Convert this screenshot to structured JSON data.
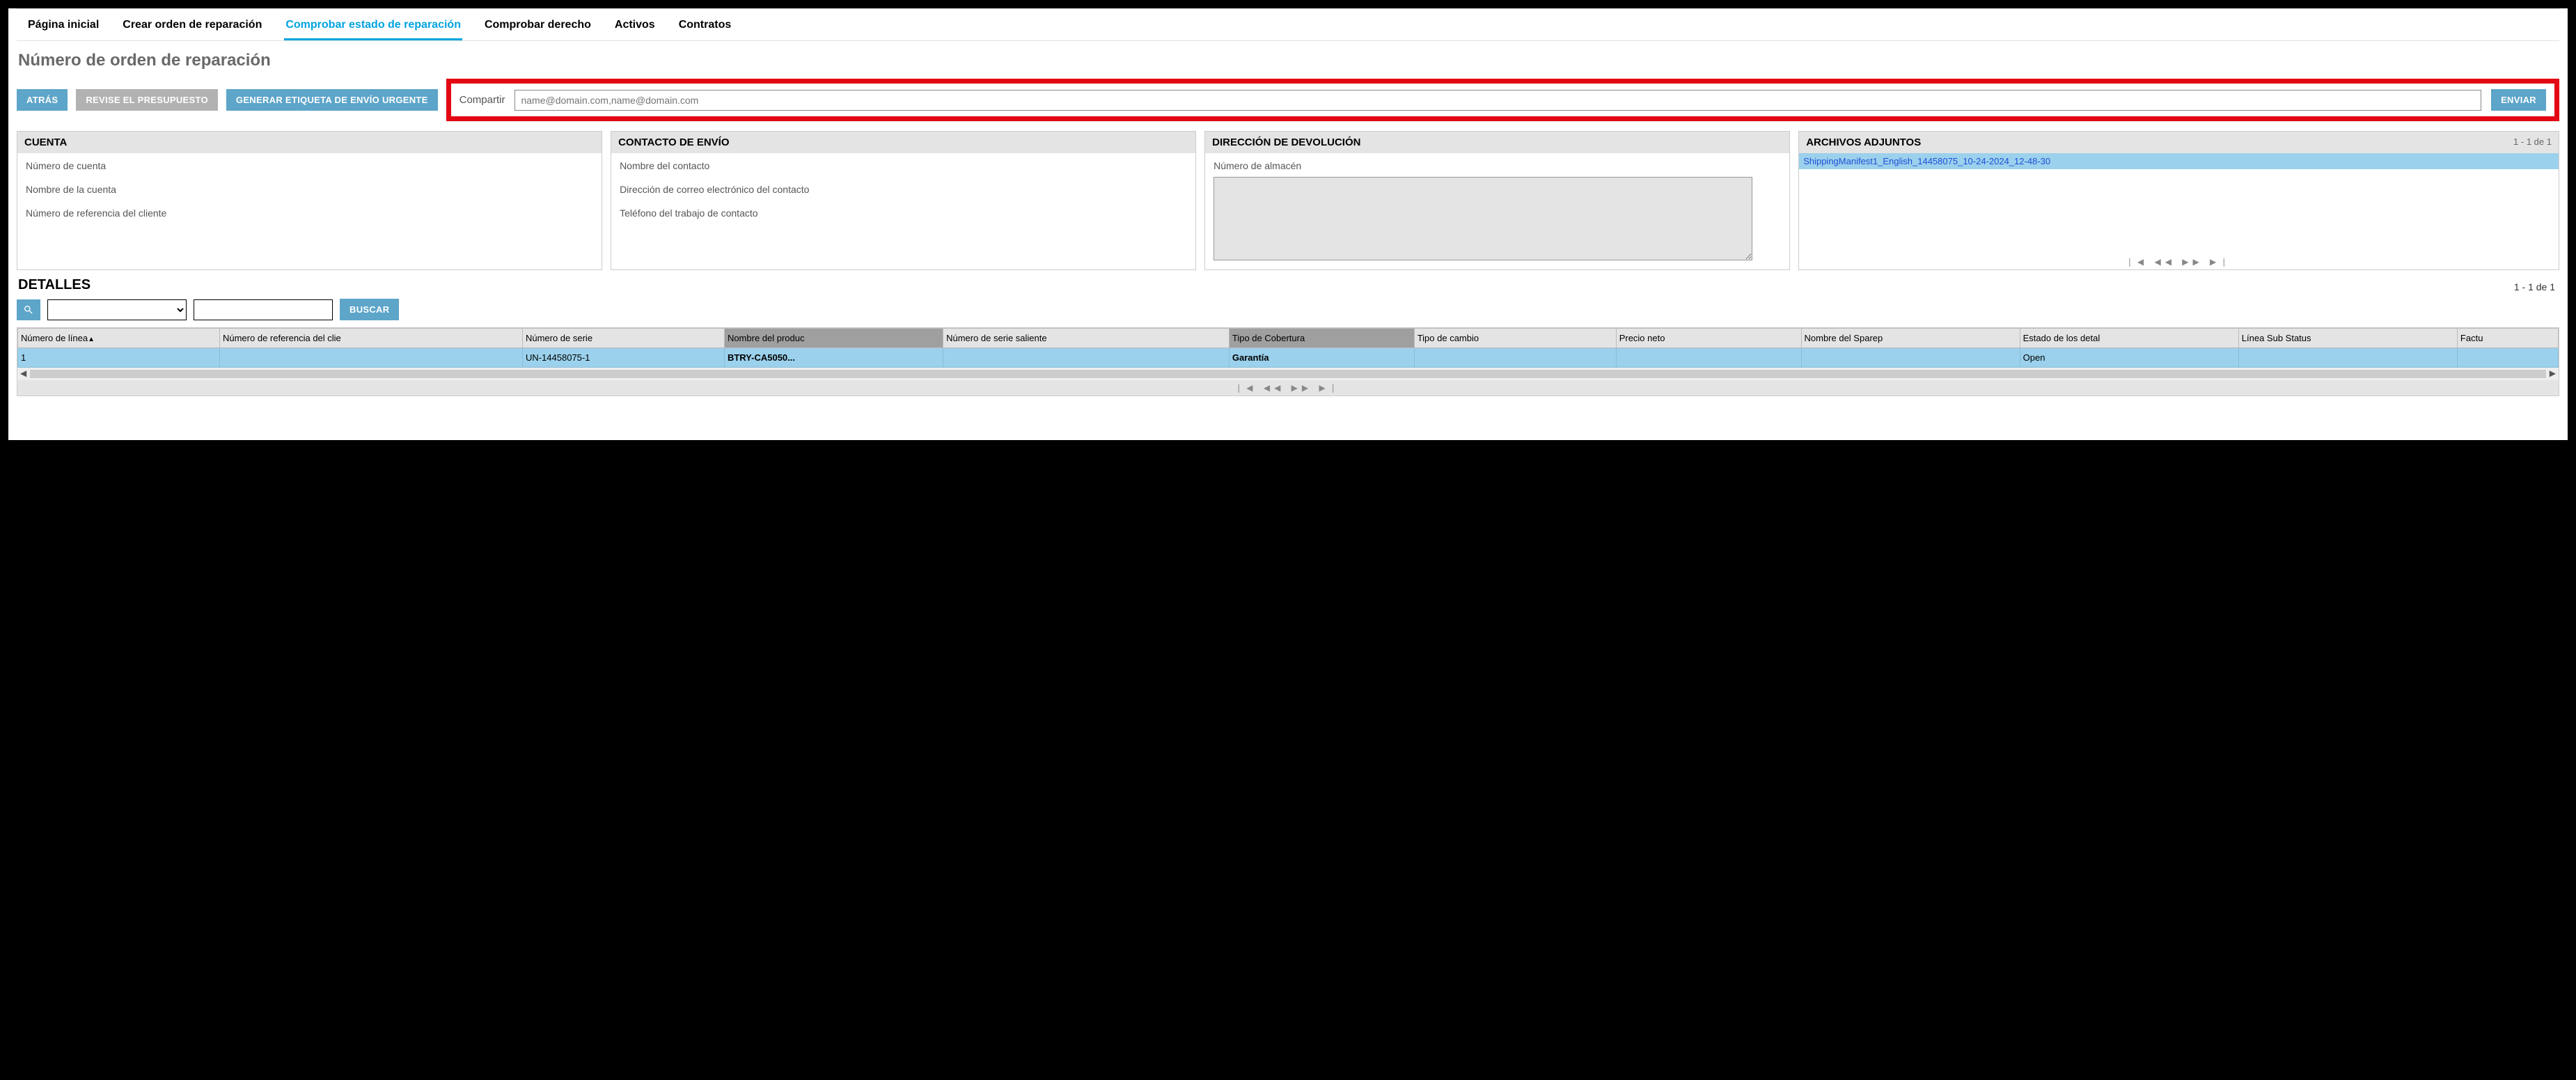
{
  "tabs": {
    "home": "Página inicial",
    "create": "Crear orden de reparación",
    "status": "Comprobar estado de reparación",
    "entitlement": "Comprobar derecho",
    "assets": "Activos",
    "contracts": "Contratos"
  },
  "page_title": "Número de orden de reparación",
  "buttons": {
    "back": "ATRÁS",
    "review_budget": "REVISE EL PRESUPUESTO",
    "gen_label": "GENERAR ETIQUETA DE ENVÍO URGENTE",
    "send": "ENVIAR",
    "search": "BUSCAR"
  },
  "share": {
    "label": "Compartir",
    "placeholder": "name@domain.com,name@domain.com"
  },
  "cards": {
    "account": {
      "title": "CUENTA",
      "f1": "Número de cuenta",
      "f2": "Nombre de la cuenta",
      "f3": "Número de referencia del cliente"
    },
    "contact": {
      "title": "CONTACTO DE ENVÍO",
      "f1": "Nombre del contacto",
      "f2": "Dirección de correo electrónico del contacto",
      "f3": "Teléfono del trabajo de contacto"
    },
    "return": {
      "title": "DIRECCIÓN DE DEVOLUCIÓN",
      "f1": "Número de almacén"
    },
    "attach": {
      "title": "ARCHIVOS ADJUNTOS",
      "counter": "1 - 1 de 1",
      "row": "ShippingManifest1_English_14458075_10-24-2024_12-48-30"
    }
  },
  "details": {
    "title": "DETALLES",
    "counter": "1 - 1 de 1",
    "cols": {
      "c1": "Número de línea",
      "c2": "Número de referencia del clie",
      "c3": "Número de serie",
      "c4": "Nombre del produc",
      "c5": "Número de serie saliente",
      "c6": "Tipo de Cobertura",
      "c7": "Tipo de cambio",
      "c8": "Precio neto",
      "c9": "Nombre del Sparep",
      "c10": "Estado de los detal",
      "c11": "Línea Sub Status",
      "c12": "Factu"
    },
    "row1": {
      "c1": "1",
      "c2": "",
      "c3": "UN-14458075-1",
      "c4": "BTRY-CA5050...",
      "c5": "",
      "c6": "Garantía",
      "c7": "",
      "c8": "",
      "c9": "",
      "c10": "Open",
      "c11": "",
      "c12": ""
    }
  }
}
